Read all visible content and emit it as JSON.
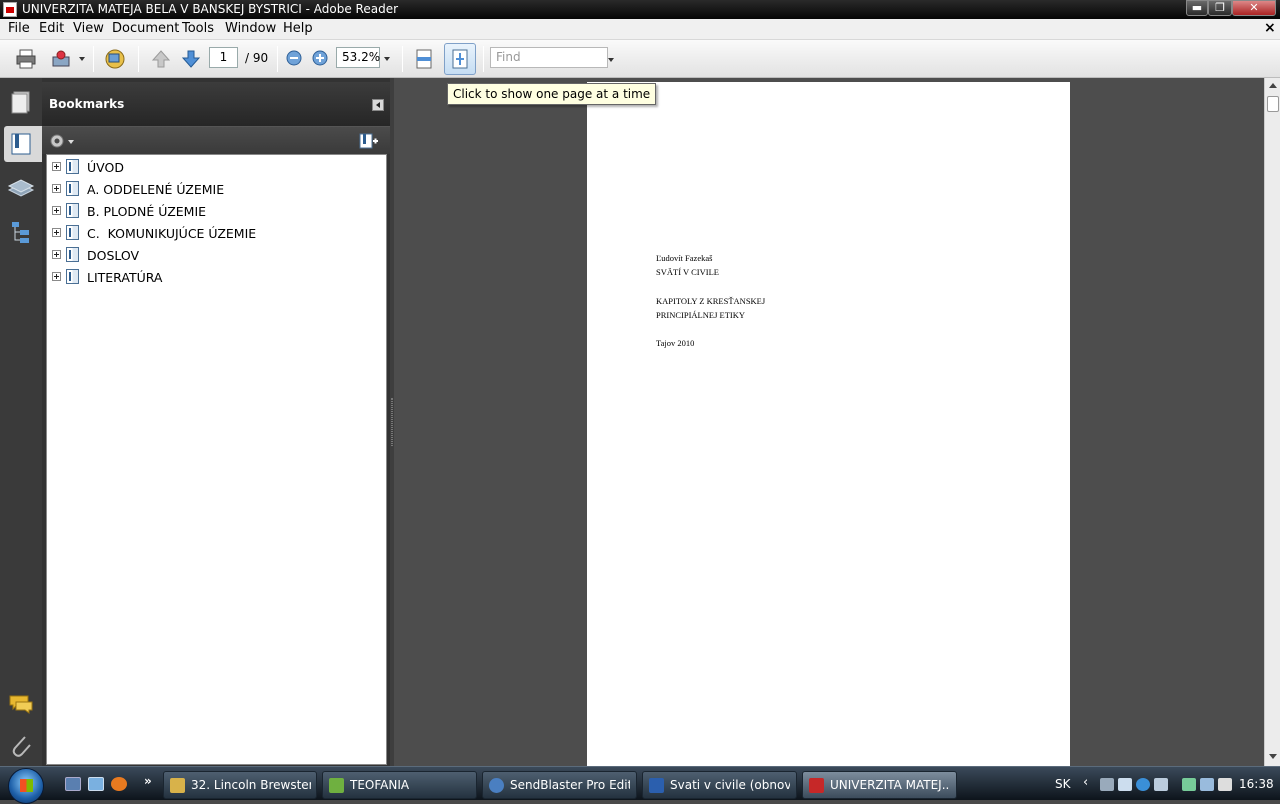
{
  "window": {
    "title": "UNIVERZITA MATEJA BELA V BANSKEJ BYSTRICI - Adobe Reader",
    "minimize": "▬",
    "maximize": "❐",
    "close": "✕",
    "doc_close": "×"
  },
  "menu": [
    "File",
    "Edit",
    "View",
    "Document",
    "Tools",
    "Window",
    "Help"
  ],
  "toolbar": {
    "page_current": "1",
    "page_total": "/ 90",
    "zoom": "53.2%",
    "find_placeholder": "Find",
    "tooltip": "Click to show one page at a time"
  },
  "bookmarks": {
    "title": "Bookmarks",
    "items": [
      {
        "label": "ÚVOD"
      },
      {
        "label": "A. ODDELENÉ ÚZEMIE"
      },
      {
        "label": "B. PLODNÉ ÚZEMIE"
      },
      {
        "label": "C.  KOMUNIKUJÚCE ÚZEMIE"
      },
      {
        "label": "DOSLOV"
      },
      {
        "label": "LITERATÚRA"
      }
    ]
  },
  "document": {
    "lines": [
      "Ľudovít Fazekaš",
      "SVÄTÍ V CIVILE",
      "KAPITOLY Z KRESŤANSKEJ",
      "PRINCIPIÁLNEJ ETIKY",
      "Tajov 2010"
    ]
  },
  "taskbar": {
    "tasks": [
      {
        "label": "32. Lincoln Brewster...",
        "icon_color": "#d8b24a"
      },
      {
        "label": "TEOFANIA",
        "icon_color": "#6fb040"
      },
      {
        "label": "SendBlaster Pro Edit...",
        "icon_color": "#4a7fc1"
      },
      {
        "label": "Svati v civile (obnov...",
        "icon_color": "#2b5fae"
      },
      {
        "label": "UNIVERZITA MATEJ...",
        "icon_color": "#c62828"
      }
    ],
    "language": "SK",
    "chevron": "‹",
    "more": "»",
    "clock": "16:38"
  }
}
